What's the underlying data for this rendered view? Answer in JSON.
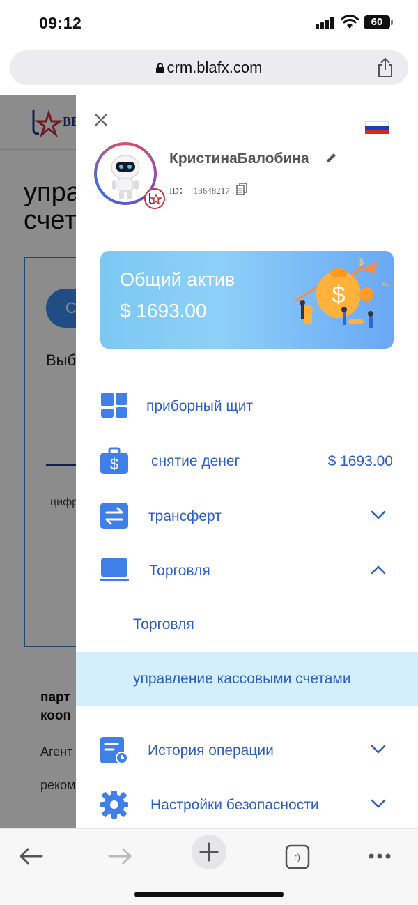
{
  "status_bar": {
    "time": "09:12",
    "battery": "60"
  },
  "browser": {
    "url": "crm.blafx.com"
  },
  "background_page": {
    "logo_text": "BE",
    "title_line1": "упра",
    "title_line2": "счет",
    "pill_text": "С",
    "select_text": "Выб",
    "small_text": "цифр",
    "heading_line1": "парт",
    "heading_line2": "кооп",
    "paragraph1": "Агент",
    "paragraph2": "реком"
  },
  "drawer": {
    "user": {
      "name": "КристинаБалобина",
      "id_label": "ID：",
      "id_value": "13648217"
    },
    "asset_card": {
      "label": "Общий актив",
      "amount": "$ 1693.00"
    },
    "menu": [
      {
        "label": "приборный щит",
        "icon": "dashboard-icon"
      },
      {
        "label": "снятие денег",
        "value": "$ 1693.00",
        "icon": "wallet-dollar-icon"
      },
      {
        "label": "трансферт",
        "icon": "transfer-arrows-icon",
        "expanded": false
      },
      {
        "label": "Торговля",
        "icon": "laptop-icon",
        "expanded": true
      },
      {
        "label": "История операции",
        "icon": "history-icon",
        "expanded": false
      },
      {
        "label": "Настройки безопасности",
        "icon": "gear-icon",
        "expanded": false
      }
    ],
    "trading_submenu": [
      {
        "label": "Торговля",
        "active": false
      },
      {
        "label": "управление кассовыми счетами",
        "active": true
      }
    ]
  },
  "colors": {
    "accent": "#2c5ecb",
    "icon_blue": "#3f7fe8",
    "active_row": "#d3eefc",
    "card_gradient_start": "#7cc8f3",
    "card_gradient_end": "#6aa8f5"
  }
}
